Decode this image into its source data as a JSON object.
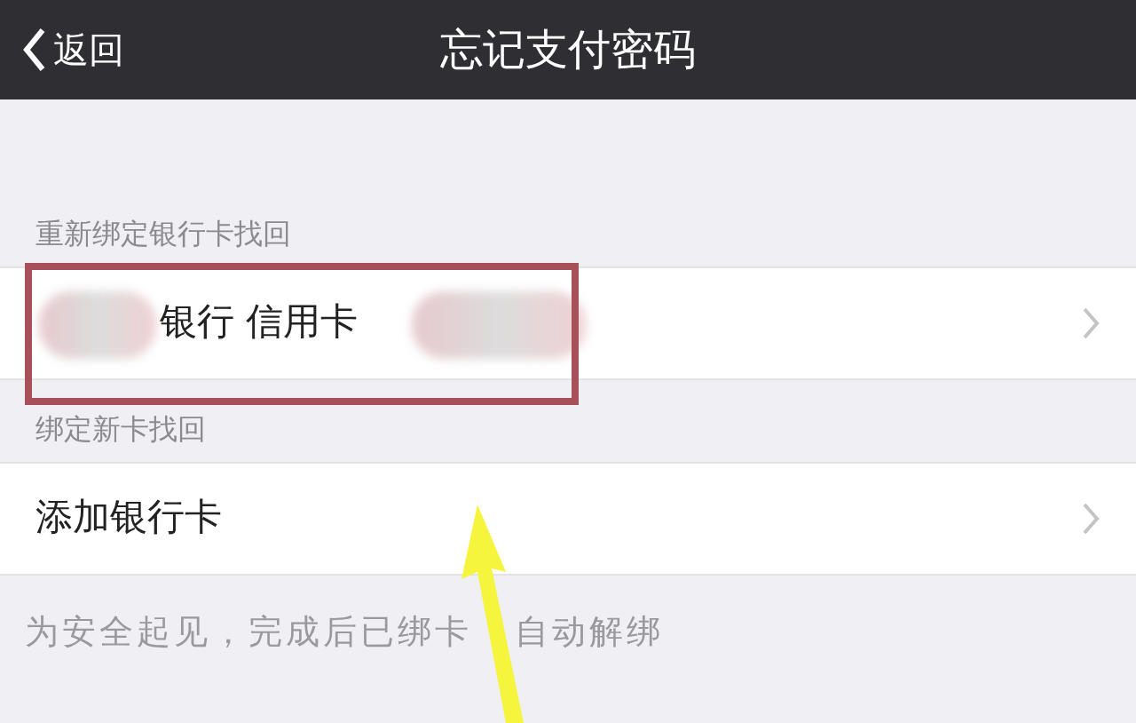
{
  "nav": {
    "back_label": "返回",
    "title": "忘记支付密码"
  },
  "sections": [
    {
      "header": "重新绑定银行卡找回",
      "rows": [
        {
          "label": "银行 信用卡",
          "highlighted": true,
          "redacted": true
        }
      ]
    },
    {
      "header": "绑定新卡找回",
      "rows": [
        {
          "label": "添加银行卡",
          "highlighted": false,
          "redacted": false
        }
      ]
    }
  ],
  "footer_note": [
    "为安全起见，完成后已绑卡",
    "自动解绑"
  ]
}
